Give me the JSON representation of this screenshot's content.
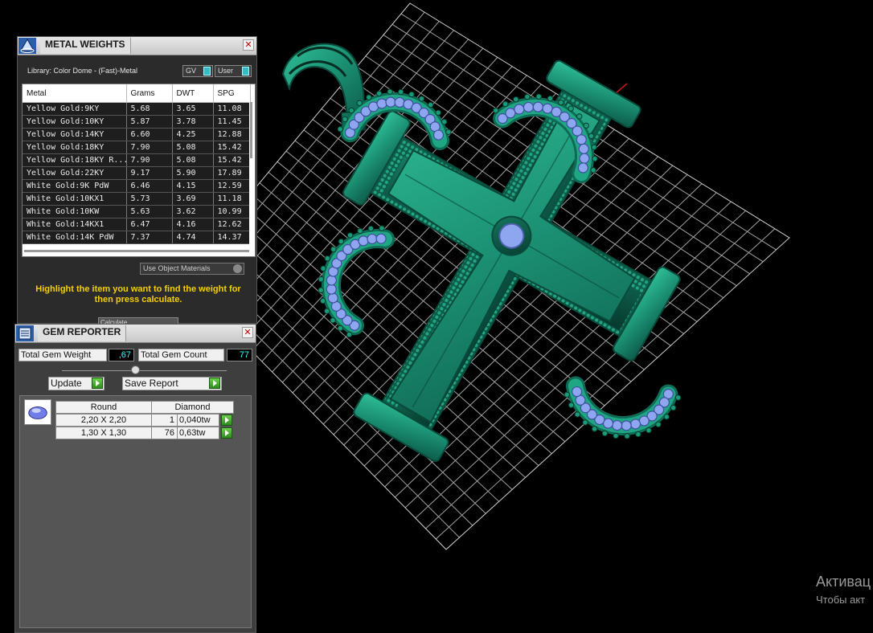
{
  "colors": {
    "background": "#000000",
    "metal_green": "#1f9e80",
    "gem_blue": "#8ea6f0",
    "grid": "#bfbfbf",
    "hint_yellow": "#f5d000",
    "value_cyan": "#33ffff"
  },
  "metal_weights": {
    "title": "METAL WEIGHTS",
    "library": "Library: Color Dome - (Fast)-Metal",
    "gv_label": "GV",
    "user_label": "User",
    "columns": [
      "Metal",
      "Grams",
      "DWT",
      "SPG"
    ],
    "rows": [
      [
        "Yellow Gold:9KY",
        "5.68",
        "3.65",
        "11.08"
      ],
      [
        "Yellow Gold:10KY",
        "5.87",
        "3.78",
        "11.45"
      ],
      [
        "Yellow Gold:14KY",
        "6.60",
        "4.25",
        "12.88"
      ],
      [
        "Yellow Gold:18KY",
        "7.90",
        "5.08",
        "15.42"
      ],
      [
        "Yellow Gold:18KY R...",
        "7.90",
        "5.08",
        "15.42"
      ],
      [
        "Yellow Gold:22KY",
        "9.17",
        "5.90",
        "17.89"
      ],
      [
        "White Gold:9K PdW",
        "6.46",
        "4.15",
        "12.59"
      ],
      [
        "White Gold:10KX1",
        "5.73",
        "3.69",
        "11.18"
      ],
      [
        "White Gold:10KW",
        "5.63",
        "3.62",
        "10.99"
      ],
      [
        "White Gold:14KX1",
        "6.47",
        "4.16",
        "12.62"
      ],
      [
        "White Gold:14K PdW",
        "7.37",
        "4.74",
        "14.37"
      ]
    ],
    "use_object_materials": "Use Object Materials",
    "hint": "Highlight the item you want to find the weight for then press calculate.",
    "calculate_label": "Calculate"
  },
  "gem_reporter": {
    "title": "GEM REPORTER",
    "total_weight_label": "Total Gem Weight",
    "total_weight_value": ",67",
    "total_count_label": "Total Gem Count",
    "total_count_value": "77",
    "update_label": "Update",
    "save_report_label": "Save Report",
    "shape": "Round",
    "material": "Diamond",
    "gems": [
      {
        "size": "2,20 X 2,20",
        "count": "1",
        "weight": "0,040tw"
      },
      {
        "size": "1,30 X 1,30",
        "count": "76",
        "weight": "0,63tw"
      }
    ]
  },
  "watermark": {
    "line1": "Активац",
    "line2": "Чтобы акт"
  }
}
